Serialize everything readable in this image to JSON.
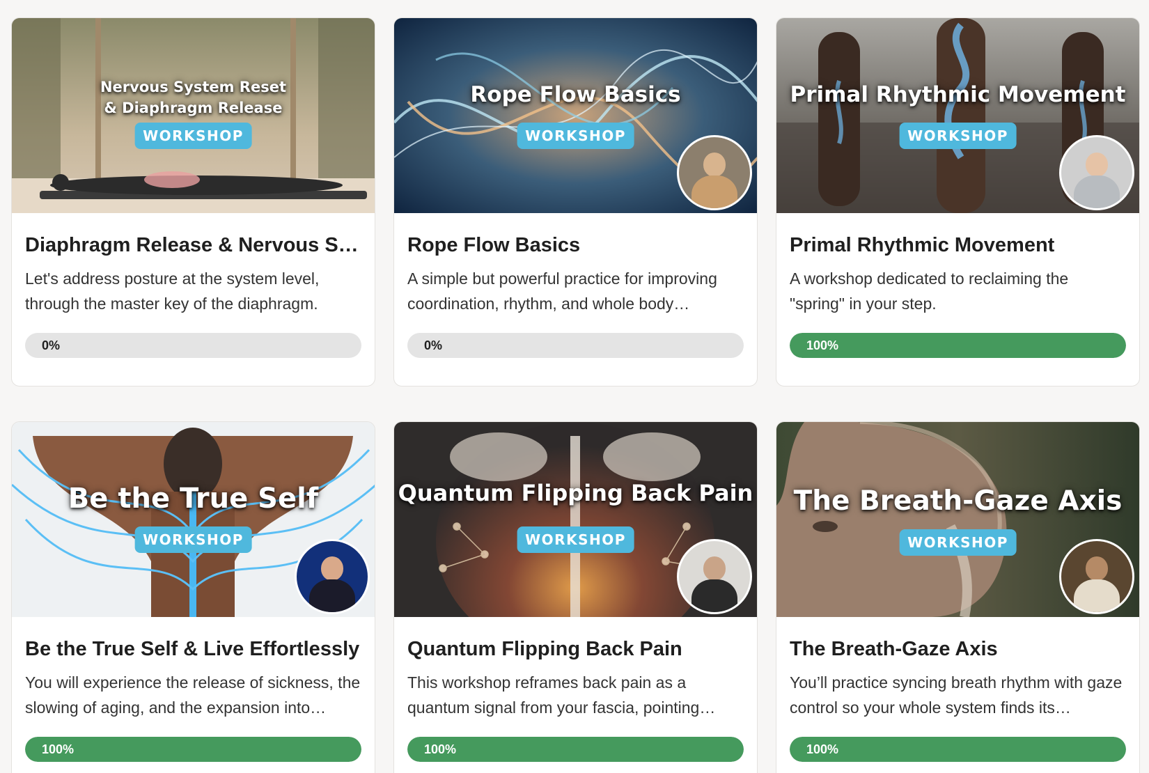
{
  "courses": [
    {
      "image_title": "Nervous System Reset & Diaphragm Release",
      "badge": "WORKSHOP",
      "title": "Diaphragm Release & Nervous Sy…",
      "description": "Let's address posture at the system level, through the master key of the diaphragm.",
      "progress_label": "0%",
      "progress": 0
    },
    {
      "image_title": "Rope Flow Basics",
      "badge": "WORKSHOP",
      "title": "Rope Flow Basics",
      "description": "A simple but powerful practice for improving coordination, rhythm, and whole body…",
      "progress_label": "0%",
      "progress": 0
    },
    {
      "image_title": "Primal Rhythmic Movement",
      "badge": "WORKSHOP",
      "title": "Primal Rhythmic Movement",
      "description": "A workshop dedicated to reclaiming the \"spring\" in your step.",
      "progress_label": "100%",
      "progress": 1
    },
    {
      "image_title": "Be the True Self",
      "badge": "WORKSHOP",
      "title": "Be the True Self & Live Effortlessly",
      "description": "You will experience the release of sickness, the slowing of aging, and the expansion into…",
      "progress_label": "100%",
      "progress": 1
    },
    {
      "image_title": "Quantum Flipping Back Pain",
      "badge": "WORKSHOP",
      "title": "Quantum Flipping Back Pain",
      "description": "This workshop reframes back pain as a quantum signal from your fascia, pointing…",
      "progress_label": "100%",
      "progress": 1
    },
    {
      "image_title": "The Breath-Gaze Axis",
      "badge": "WORKSHOP",
      "title": "The Breath-Gaze Axis",
      "description": "You’ll practice syncing breath rhythm with gaze control so your whole system finds its…",
      "progress_label": "100%",
      "progress": 1
    }
  ],
  "colors": {
    "badge": "#4fb8dd",
    "progress_complete": "#459a5d",
    "progress_track": "#e4e4e4"
  }
}
